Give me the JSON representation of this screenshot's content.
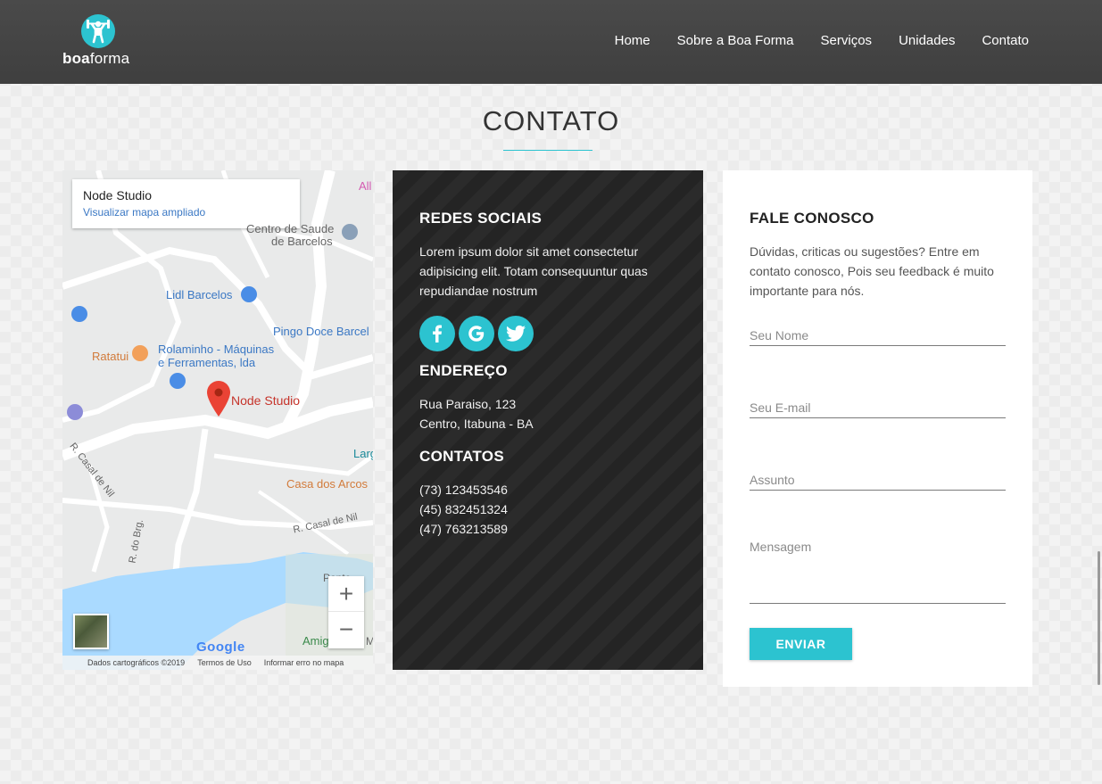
{
  "brand": {
    "name_bold": "boa",
    "name_regular": "forma",
    "accent_color": "#2cc3d0"
  },
  "nav": {
    "items": [
      "Home",
      "Sobre a Boa Forma",
      "Serviços",
      "Unidades",
      "Contato"
    ]
  },
  "section": {
    "title": "CONTATO"
  },
  "map": {
    "card": {
      "title": "Node Studio",
      "link": "Visualizar mapa ampliado"
    },
    "pin_label": "Node Studio",
    "labels": {
      "centro_saude_1": "Centro de Saude",
      "centro_saude_2": "de Barcelos",
      "lidl": "Lidl Barcelos",
      "pingo_doce": "Pingo Doce Barcel",
      "ratatui": "Ratatui",
      "rolaminho_1": "Rolaminho - Máquinas",
      "rolaminho_2": "e Ferramentas, lda",
      "casa_dos_arcos": "Casa dos Arcos",
      "casal_de_nil_1": "R. Casal de Nil",
      "casal_de_nil_2": "R. Casal de Nil",
      "do_brg": "R. do Brg.",
      "larg": "Larg",
      "all": "All",
      "amig": "Amig",
      "m": "M",
      "ponte": "Ponte"
    },
    "zoom_in": "+",
    "zoom_out": "−",
    "google": "Google",
    "footer": [
      "Dados cartográficos ©2019",
      "Termos de Uso",
      "Informar erro no mapa"
    ]
  },
  "social": {
    "heading": "REDES SOCIAIS",
    "text": "Lorem ipsum dolor sit amet consectetur adipisicing elit. Totam consequuntur quas repudiandae nostrum",
    "icons": [
      "facebook-icon",
      "google-icon",
      "twitter-icon"
    ]
  },
  "address": {
    "heading": "ENDEREÇO",
    "line1": "Rua Paraiso, 123",
    "line2": "Centro, Itabuna - BA"
  },
  "contacts": {
    "heading": "CONTATOS",
    "phones": [
      "(73) 123453546",
      "(45) 832451324",
      "(47) 763213589"
    ]
  },
  "form": {
    "heading": "FALE CONOSCO",
    "intro": "Dúvidas, criticas ou sugestões? Entre em contato conosco, Pois seu feedback é muito importante para nós.",
    "name_placeholder": "Seu Nome",
    "email_placeholder": "Seu E-mail",
    "subject_placeholder": "Assunto",
    "message_placeholder": "Mensagem",
    "submit": "ENVIAR"
  }
}
